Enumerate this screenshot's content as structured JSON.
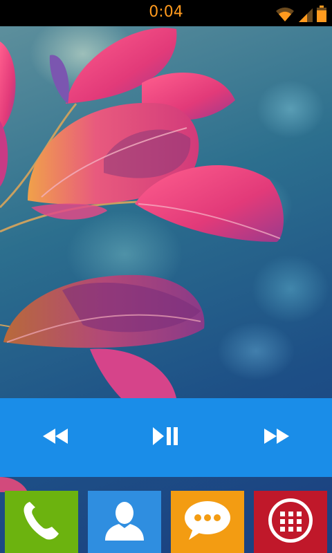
{
  "status_bar": {
    "time": "0:04",
    "time_color": "#ff9a1e",
    "icons": [
      "wifi-icon",
      "signal-icon",
      "battery-icon"
    ]
  },
  "wallpaper": {
    "subject": "pink-leaves"
  },
  "music_widget": {
    "background_color": "#1a8de8",
    "controls": [
      "previous-icon",
      "play-pause-icon",
      "next-icon"
    ]
  },
  "dock": {
    "tiles": [
      {
        "app": "phone",
        "icon": "phone-icon",
        "color": "#6cb30f"
      },
      {
        "app": "contacts",
        "icon": "contacts-icon",
        "color": "#2f8ee0"
      },
      {
        "app": "messages",
        "icon": "messages-icon",
        "color": "#f39c12"
      },
      {
        "app": "apps",
        "icon": "apps-grid-icon",
        "color": "#c0182a"
      }
    ]
  }
}
